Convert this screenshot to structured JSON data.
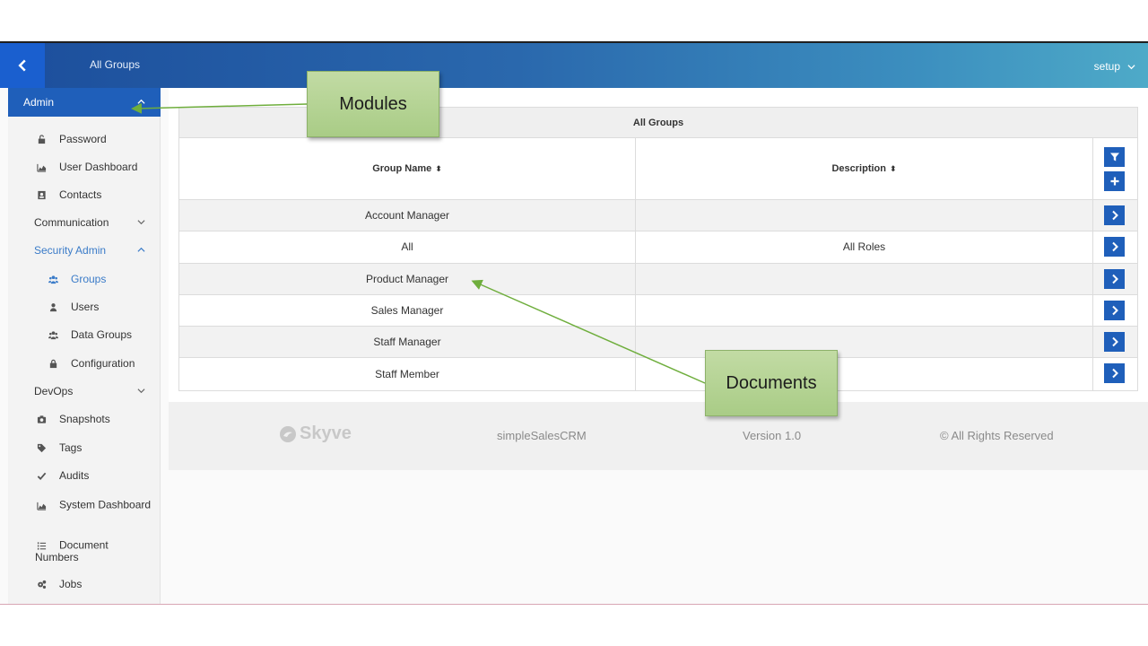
{
  "header": {
    "title": "All Groups",
    "user_menu": "setup"
  },
  "sidebar": {
    "module": "Admin",
    "items": [
      {
        "label": "Password",
        "icon": "lock-open-icon"
      },
      {
        "label": "User Dashboard",
        "icon": "area-chart-icon"
      },
      {
        "label": "Contacts",
        "icon": "contact-card-icon"
      },
      {
        "label": "Communication",
        "group": true
      },
      {
        "label": "Security Admin",
        "group": true,
        "expanded": true
      },
      {
        "label": "Groups",
        "icon": "users-icon",
        "active": true
      },
      {
        "label": "Users",
        "icon": "user-icon"
      },
      {
        "label": "Data Groups",
        "icon": "users-icon"
      },
      {
        "label": "Configuration",
        "icon": "lock-icon"
      },
      {
        "label": "DevOps",
        "group": true
      },
      {
        "label": "Snapshots",
        "icon": "camera-icon"
      },
      {
        "label": "Tags",
        "icon": "tag-icon"
      },
      {
        "label": "Audits",
        "icon": "check-icon"
      },
      {
        "label": "System Dashboard",
        "icon": "area-chart-icon"
      },
      {
        "label": "Document Numbers",
        "icon": "list-ol-icon"
      },
      {
        "label": "Jobs",
        "icon": "cogs-icon"
      }
    ]
  },
  "grid": {
    "title": "All Groups",
    "columns": [
      "Group Name",
      "Description"
    ],
    "rows": [
      {
        "name": "Account Manager",
        "description": ""
      },
      {
        "name": "All",
        "description": "All Roles"
      },
      {
        "name": "Product Manager",
        "description": ""
      },
      {
        "name": "Sales Manager",
        "description": ""
      },
      {
        "name": "Staff Manager",
        "description": ""
      },
      {
        "name": "Staff Member",
        "description": ""
      }
    ]
  },
  "footer": {
    "logo_text": "Skyve",
    "app_name": "simpleSalesCRM",
    "version": "Version 1.0",
    "rights": "© All Rights Reserved"
  },
  "annotations": {
    "modules": "Modules",
    "documents": "Documents"
  },
  "colors": {
    "accent": "#1f5fba",
    "active_link": "#3a7bc8",
    "callout": "#b6d596"
  }
}
